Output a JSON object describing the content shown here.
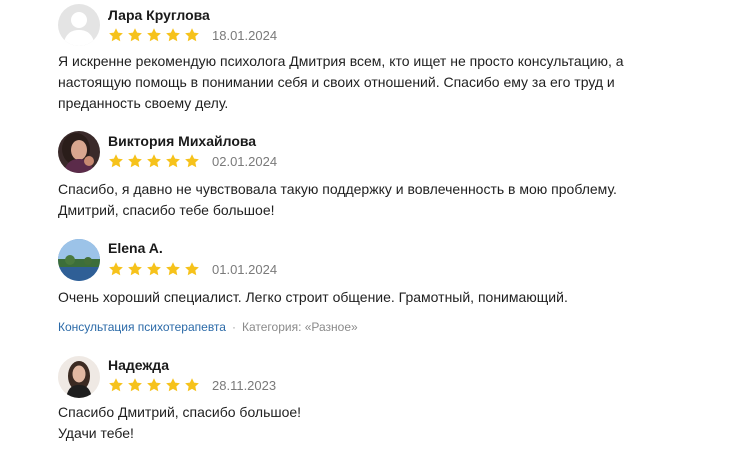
{
  "colors": {
    "star": "#f6c21b",
    "link": "#2b6aa8",
    "date": "#7a7a7a"
  },
  "reviews": [
    {
      "author": "Лара Круглова",
      "rating": 5,
      "date": "18.01.2024",
      "avatar": "default-avatar-icon",
      "lines": [
        "Я искренне рекомендую психолога Дмитрия всем, кто ищет не просто консультацию, а",
        "настоящую помощь в понимании себя и своих отношений. Спасибо ему за его труд и",
        "преданность своему делу."
      ]
    },
    {
      "author": "Виктория Михайлова",
      "rating": 5,
      "date": "02.01.2024",
      "avatar": "photo-avatar",
      "lines": [
        "Спасибо, я давно не чувствовала такую поддержку и вовлеченность в мою проблему.",
        "Дмитрий, спасибо тебе большое!"
      ]
    },
    {
      "author": "Elena A.",
      "rating": 5,
      "date": "01.01.2024",
      "avatar": "landscape-photo-avatar",
      "lines": [
        "Очень хороший специалист. Легко строит общение. Грамотный, понимающий."
      ],
      "service": "Консультация психотерапевта",
      "separator": "·",
      "category": "Категория: «Разное»"
    },
    {
      "author": "Надежда",
      "rating": 5,
      "date": "28.11.2023",
      "avatar": "photo-avatar",
      "lines": [
        "Спасибо Дмитрий, спасибо большое!",
        "Удачи тебе!"
      ]
    }
  ]
}
